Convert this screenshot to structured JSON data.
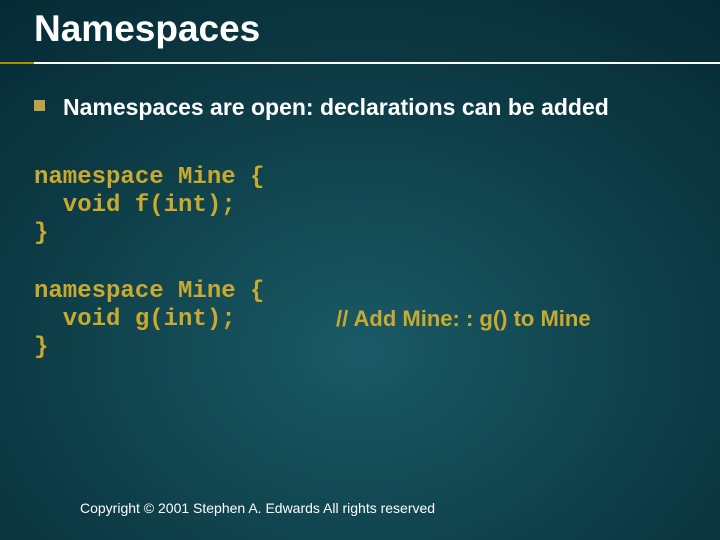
{
  "title": "Namespaces",
  "bullet": "Namespaces are open: declarations can be added",
  "code_block_1": "namespace Mine {\n  void f(int);\n}",
  "code_block_2": "namespace Mine {\n  void g(int);\n}",
  "comment": "// Add Mine: : g() to Mine",
  "copyright": "Copyright © 2001 Stephen A. Edwards  All rights reserved"
}
